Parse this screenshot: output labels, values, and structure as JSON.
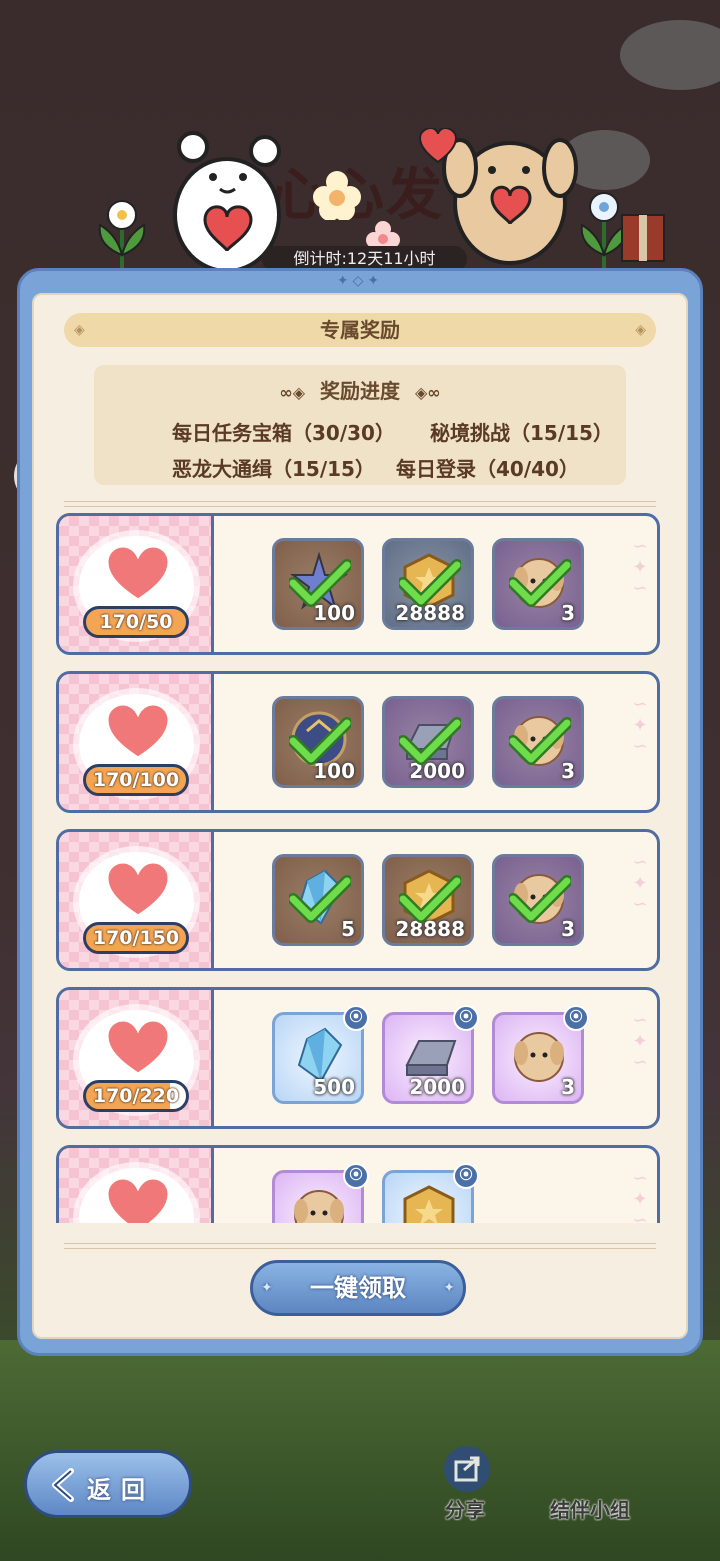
{
  "header": {
    "title_partial": "心心发",
    "countdown": "倒计时:12天11小时"
  },
  "panel": {
    "title": "专属奖励",
    "progress": {
      "title": "奖励进度",
      "items": [
        "每日任务宝箱（30/30）",
        "秘境挑战（15/15）",
        "恶龙大通缉（15/15）",
        "每日登录（40/40）"
      ]
    },
    "tiers": [
      {
        "progress_label": "170/50",
        "rewards": [
          {
            "icon": "star-crystal-icon",
            "qty": "100",
            "color": "brown",
            "claimed": true
          },
          {
            "icon": "gold-coin-icon",
            "qty": "28888",
            "color": "blue",
            "claimed": true
          },
          {
            "icon": "puppy-avatar-icon",
            "qty": "3",
            "color": "purple",
            "claimed": true
          }
        ]
      },
      {
        "progress_label": "170/100",
        "rewards": [
          {
            "icon": "orb-icon",
            "qty": "100",
            "color": "brown",
            "claimed": true
          },
          {
            "icon": "metal-ingot-icon",
            "qty": "2000",
            "color": "purple",
            "claimed": true
          },
          {
            "icon": "puppy-avatar-icon",
            "qty": "3",
            "color": "purple",
            "claimed": true
          }
        ]
      },
      {
        "progress_label": "170/150",
        "rewards": [
          {
            "icon": "blue-crystal-icon",
            "qty": "5",
            "color": "brown",
            "claimed": true
          },
          {
            "icon": "gold-coin-icon",
            "qty": "28888",
            "color": "brown",
            "claimed": true
          },
          {
            "icon": "puppy-avatar-icon",
            "qty": "3",
            "color": "purple",
            "claimed": true
          }
        ]
      },
      {
        "progress_label": "170/220",
        "rewards": [
          {
            "icon": "blue-crystal-icon",
            "qty": "500",
            "color": "light-blue",
            "claimed": false
          },
          {
            "icon": "metal-ingot-icon",
            "qty": "2000",
            "color": "light-purple",
            "claimed": false
          },
          {
            "icon": "puppy-avatar-icon",
            "qty": "3",
            "color": "light-purple",
            "claimed": false
          }
        ]
      },
      {
        "progress_label": "",
        "rewards": [
          {
            "icon": "puppy-avatar-icon",
            "qty": "",
            "color": "light-purple",
            "claimed": false
          },
          {
            "icon": "gold-coin-icon",
            "qty": "",
            "color": "light-blue",
            "claimed": false
          }
        ]
      }
    ],
    "claim_all_label": "一键领取"
  },
  "footer": {
    "back_label": "返回",
    "share_label": "分享",
    "group_label": "结伴小组"
  },
  "colors": {
    "panel_blue": "#7aa3d8",
    "badge_orange": "#f3a553",
    "check_green": "#6fdc4c",
    "heart_red": "#f07878"
  }
}
